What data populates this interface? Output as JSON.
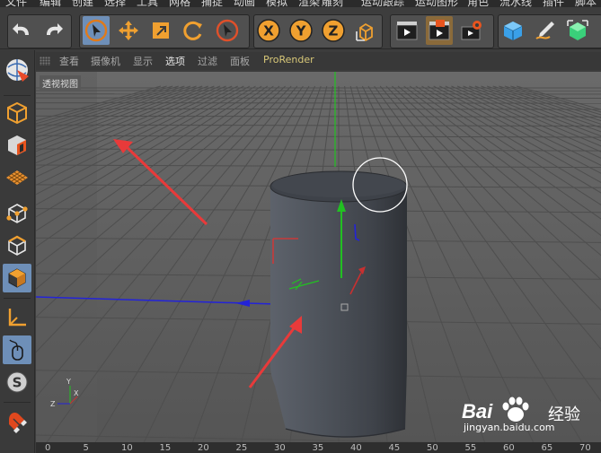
{
  "menu": {
    "items": [
      {
        "label": "文件"
      },
      {
        "label": "编辑"
      },
      {
        "label": "创建"
      },
      {
        "label": "选择"
      },
      {
        "label": "工具"
      },
      {
        "label": "网格"
      },
      {
        "label": "捕捉"
      },
      {
        "label": "动画"
      },
      {
        "label": "模拟"
      },
      {
        "label": "渲染"
      },
      {
        "label": "雕刻"
      },
      {
        "label": "运动跟踪"
      },
      {
        "label": "运动图形"
      },
      {
        "label": "角色"
      },
      {
        "label": "流水线"
      },
      {
        "label": "插件"
      },
      {
        "label": "脚本"
      }
    ]
  },
  "toolbar": {
    "undo_icon": "undo-icon",
    "redo_icon": "redo-icon",
    "tools": [
      "select-live-icon",
      "move-icon",
      "scale-icon",
      "rotate-icon",
      "select-recent-icon"
    ],
    "axis_x": "X",
    "axis_y": "Y",
    "axis_z": "Z",
    "coord_icon": "world-coordinates-icon",
    "render_tools": [
      "render-view-icon",
      "render-picture-viewer-icon",
      "render-settings-icon"
    ],
    "object_tools": [
      "cube-icon",
      "pen-icon",
      "subdivision-icon"
    ]
  },
  "left_toolbar": {
    "modes": [
      "make-editable-icon",
      "model-mode-icon",
      "texture-mode-icon",
      "workplane-icon",
      "points-mode-icon",
      "edges-mode-icon",
      "polygons-mode-icon",
      "axis-mode-icon",
      "tweak-mode-icon",
      "snap-icon",
      "magnet-icon"
    ]
  },
  "viewport_menu": {
    "items": [
      {
        "label": "查看",
        "active": false
      },
      {
        "label": "摄像机",
        "active": false
      },
      {
        "label": "显示",
        "active": false
      },
      {
        "label": "选项",
        "active": true
      },
      {
        "label": "过滤",
        "active": false
      },
      {
        "label": "面板",
        "active": false
      },
      {
        "label": "ProRender",
        "active": false
      }
    ]
  },
  "viewport": {
    "label": "透视视图",
    "axis_gizmo": {
      "y": "Y",
      "z": "Z",
      "x": "X"
    },
    "colors": {
      "background": "#5a5a5a",
      "grid": "#4e4e4e",
      "cylinder": "#4a4f57",
      "y_axis": "#22c022",
      "x_axis": "#2323d8",
      "annotation_arrow": "#e83a3a"
    }
  },
  "timeline": {
    "ticks": [
      "0",
      "5",
      "10",
      "15",
      "20",
      "25",
      "30",
      "35",
      "40",
      "45",
      "50",
      "55",
      "60",
      "65",
      "70"
    ]
  },
  "watermark": {
    "brand": "Bai",
    "brand_suffix": "经验",
    "url": "jingyan.baidu.com"
  }
}
